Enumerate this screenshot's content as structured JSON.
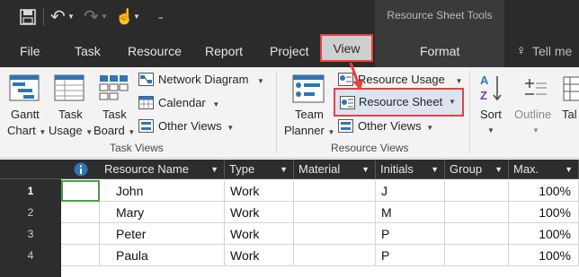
{
  "title_bar": {
    "contextual_group": "Resource Sheet Tools"
  },
  "tabs": [
    "File",
    "Task",
    "Resource",
    "Report",
    "Project",
    "View",
    "Format",
    "Tell me"
  ],
  "ribbon": {
    "task_views": {
      "label": "Task Views",
      "gantt": [
        "Gantt",
        "Chart"
      ],
      "task_usage": [
        "Task",
        "Usage"
      ],
      "task_board": [
        "Task",
        "Board"
      ],
      "network_diagram": "Network Diagram",
      "calendar": "Calendar",
      "other_views": "Other Views"
    },
    "resource_views": {
      "label": "Resource Views",
      "team_planner": [
        "Team",
        "Planner"
      ],
      "resource_usage": "Resource Usage",
      "resource_sheet": "Resource Sheet",
      "other_views": "Other Views"
    },
    "sort": "Sort",
    "outline": "Outline",
    "tables_partial": "Tal"
  },
  "sheet": {
    "columns": [
      "Resource Name",
      "Type",
      "Material",
      "Initials",
      "Group",
      "Max."
    ],
    "rows": [
      {
        "id": "1",
        "name": "John",
        "type": "Work",
        "material": "",
        "initials": "J",
        "group": "",
        "max": "100%"
      },
      {
        "id": "2",
        "name": "Mary",
        "type": "Work",
        "material": "",
        "initials": "M",
        "group": "",
        "max": "100%"
      },
      {
        "id": "3",
        "name": "Peter",
        "type": "Work",
        "material": "",
        "initials": "P",
        "group": "",
        "max": "100%"
      },
      {
        "id": "4",
        "name": "Paula",
        "type": "Work",
        "material": "",
        "initials": "P",
        "group": "",
        "max": "100%"
      }
    ]
  },
  "colors": {
    "highlight": "#e8403f",
    "title_bar": "#2b2b2b",
    "ribbon": "#f3f3f3"
  }
}
